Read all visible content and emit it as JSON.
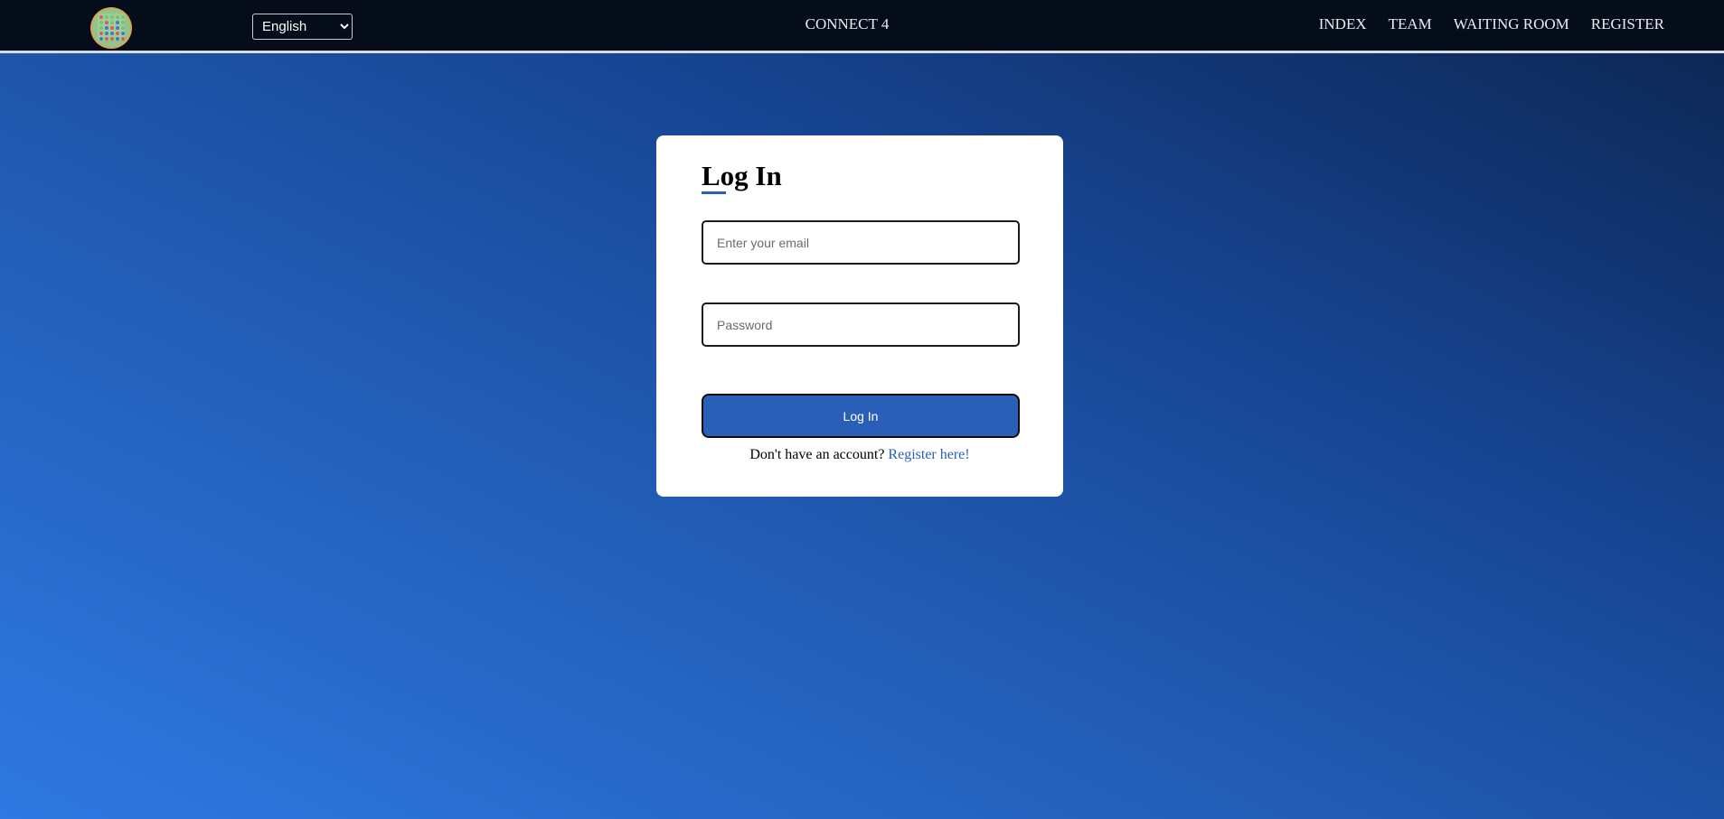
{
  "nav": {
    "language_selected": "English",
    "brand": "CONNECT 4",
    "links": [
      {
        "label": "INDEX"
      },
      {
        "label": "TEAM"
      },
      {
        "label": "WAITING ROOM"
      },
      {
        "label": "REGISTER"
      }
    ]
  },
  "login": {
    "title": "Log In",
    "email_placeholder": "Enter your email",
    "password_placeholder": "Password",
    "button_label": "Log In",
    "no_account_text": "Don't have an account?",
    "register_link": "Register here!"
  },
  "colors": {
    "navbar_bg": "#050c1a",
    "accent": "#2a5fb8",
    "bg_gradient_start": "#2f79e3",
    "bg_gradient_end": "#0c244f"
  }
}
